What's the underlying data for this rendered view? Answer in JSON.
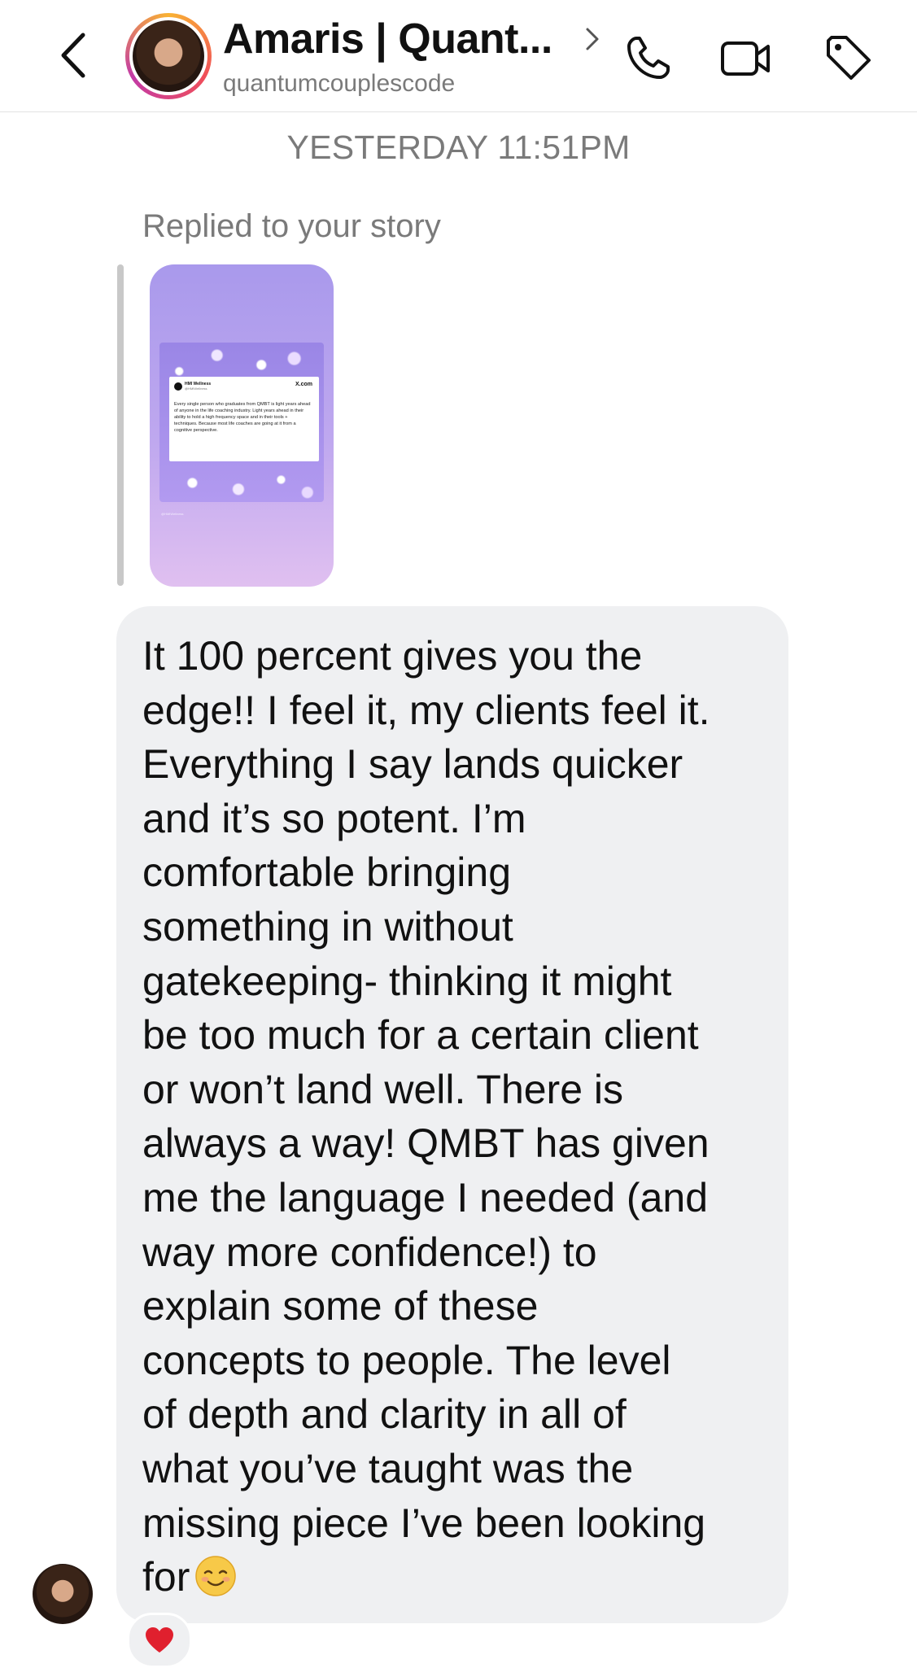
{
  "header": {
    "name": "Amaris | Quant...",
    "handle": "quantumcouplescode"
  },
  "icons": {
    "back": "chevron-left-icon",
    "profile_chevron": "chevron-right-icon",
    "call": "phone-icon",
    "video": "video-camera-icon",
    "tag": "tag-icon",
    "reaction": "red-heart-icon",
    "emoji": "smiling-face-icon"
  },
  "thread": {
    "timestamp": "YESTERDAY 11:51PM",
    "replied_label": "Replied to your story"
  },
  "story": {
    "author": "HMI Wellness",
    "handle": "@HMIWellness",
    "source": "X.com",
    "text": "Every single person who graduates from QMBT is light years ahead of anyone in the life coaching industry. Light years ahead in their ability to hold a high frequency space and in their tools + techniques. Because most life coaches are going at it from a cognitive perspective."
  },
  "message": {
    "lines": [
      "It 100 percent gives you the",
      "edge!! I feel it, my clients feel it.",
      "Everything I say lands quicker",
      "and it’s so potent. I’m",
      "comfortable bringing",
      "something in without",
      "gatekeeping- thinking it might",
      "be too much for a certain client",
      "or won’t land well. There is",
      "always a way! QMBT has given",
      "me the language I needed (and",
      "way more confidence!) to",
      "explain some of these",
      "concepts to people. The level",
      "of depth and clarity in all of",
      "what you’ve taught was the",
      "missing piece I’ve been looking",
      "for"
    ]
  },
  "colors": {
    "bubble": "#eff0f2",
    "muted_text": "#7a7a7a",
    "heart": "#e0202e",
    "story_top": "#a999ec",
    "story_bottom": "#e0c0f0"
  }
}
